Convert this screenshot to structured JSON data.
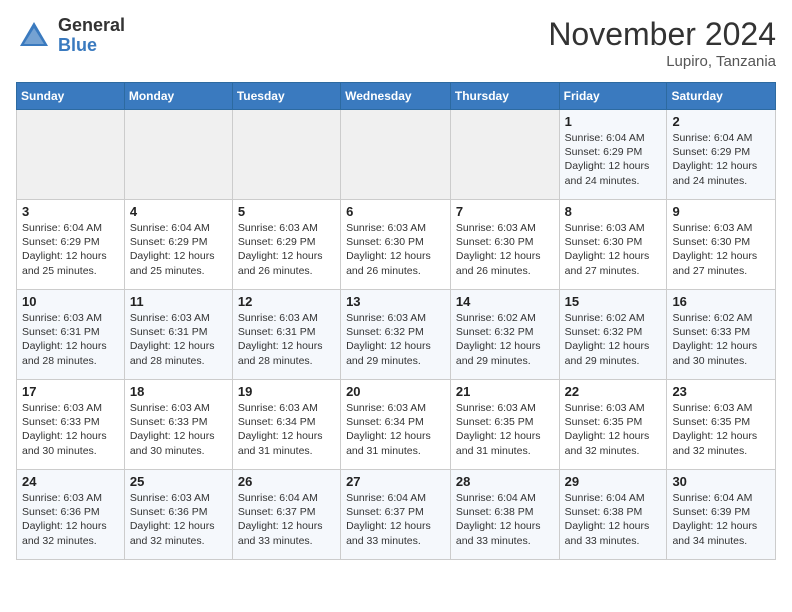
{
  "header": {
    "logo_general": "General",
    "logo_blue": "Blue",
    "month_title": "November 2024",
    "location": "Lupiro, Tanzania"
  },
  "weekdays": [
    "Sunday",
    "Monday",
    "Tuesday",
    "Wednesday",
    "Thursday",
    "Friday",
    "Saturday"
  ],
  "weeks": [
    [
      {
        "day": "",
        "info": ""
      },
      {
        "day": "",
        "info": ""
      },
      {
        "day": "",
        "info": ""
      },
      {
        "day": "",
        "info": ""
      },
      {
        "day": "",
        "info": ""
      },
      {
        "day": "1",
        "info": "Sunrise: 6:04 AM\nSunset: 6:29 PM\nDaylight: 12 hours and 24 minutes."
      },
      {
        "day": "2",
        "info": "Sunrise: 6:04 AM\nSunset: 6:29 PM\nDaylight: 12 hours and 24 minutes."
      }
    ],
    [
      {
        "day": "3",
        "info": "Sunrise: 6:04 AM\nSunset: 6:29 PM\nDaylight: 12 hours and 25 minutes."
      },
      {
        "day": "4",
        "info": "Sunrise: 6:04 AM\nSunset: 6:29 PM\nDaylight: 12 hours and 25 minutes."
      },
      {
        "day": "5",
        "info": "Sunrise: 6:03 AM\nSunset: 6:29 PM\nDaylight: 12 hours and 26 minutes."
      },
      {
        "day": "6",
        "info": "Sunrise: 6:03 AM\nSunset: 6:30 PM\nDaylight: 12 hours and 26 minutes."
      },
      {
        "day": "7",
        "info": "Sunrise: 6:03 AM\nSunset: 6:30 PM\nDaylight: 12 hours and 26 minutes."
      },
      {
        "day": "8",
        "info": "Sunrise: 6:03 AM\nSunset: 6:30 PM\nDaylight: 12 hours and 27 minutes."
      },
      {
        "day": "9",
        "info": "Sunrise: 6:03 AM\nSunset: 6:30 PM\nDaylight: 12 hours and 27 minutes."
      }
    ],
    [
      {
        "day": "10",
        "info": "Sunrise: 6:03 AM\nSunset: 6:31 PM\nDaylight: 12 hours and 28 minutes."
      },
      {
        "day": "11",
        "info": "Sunrise: 6:03 AM\nSunset: 6:31 PM\nDaylight: 12 hours and 28 minutes."
      },
      {
        "day": "12",
        "info": "Sunrise: 6:03 AM\nSunset: 6:31 PM\nDaylight: 12 hours and 28 minutes."
      },
      {
        "day": "13",
        "info": "Sunrise: 6:03 AM\nSunset: 6:32 PM\nDaylight: 12 hours and 29 minutes."
      },
      {
        "day": "14",
        "info": "Sunrise: 6:02 AM\nSunset: 6:32 PM\nDaylight: 12 hours and 29 minutes."
      },
      {
        "day": "15",
        "info": "Sunrise: 6:02 AM\nSunset: 6:32 PM\nDaylight: 12 hours and 29 minutes."
      },
      {
        "day": "16",
        "info": "Sunrise: 6:02 AM\nSunset: 6:33 PM\nDaylight: 12 hours and 30 minutes."
      }
    ],
    [
      {
        "day": "17",
        "info": "Sunrise: 6:03 AM\nSunset: 6:33 PM\nDaylight: 12 hours and 30 minutes."
      },
      {
        "day": "18",
        "info": "Sunrise: 6:03 AM\nSunset: 6:33 PM\nDaylight: 12 hours and 30 minutes."
      },
      {
        "day": "19",
        "info": "Sunrise: 6:03 AM\nSunset: 6:34 PM\nDaylight: 12 hours and 31 minutes."
      },
      {
        "day": "20",
        "info": "Sunrise: 6:03 AM\nSunset: 6:34 PM\nDaylight: 12 hours and 31 minutes."
      },
      {
        "day": "21",
        "info": "Sunrise: 6:03 AM\nSunset: 6:35 PM\nDaylight: 12 hours and 31 minutes."
      },
      {
        "day": "22",
        "info": "Sunrise: 6:03 AM\nSunset: 6:35 PM\nDaylight: 12 hours and 32 minutes."
      },
      {
        "day": "23",
        "info": "Sunrise: 6:03 AM\nSunset: 6:35 PM\nDaylight: 12 hours and 32 minutes."
      }
    ],
    [
      {
        "day": "24",
        "info": "Sunrise: 6:03 AM\nSunset: 6:36 PM\nDaylight: 12 hours and 32 minutes."
      },
      {
        "day": "25",
        "info": "Sunrise: 6:03 AM\nSunset: 6:36 PM\nDaylight: 12 hours and 32 minutes."
      },
      {
        "day": "26",
        "info": "Sunrise: 6:04 AM\nSunset: 6:37 PM\nDaylight: 12 hours and 33 minutes."
      },
      {
        "day": "27",
        "info": "Sunrise: 6:04 AM\nSunset: 6:37 PM\nDaylight: 12 hours and 33 minutes."
      },
      {
        "day": "28",
        "info": "Sunrise: 6:04 AM\nSunset: 6:38 PM\nDaylight: 12 hours and 33 minutes."
      },
      {
        "day": "29",
        "info": "Sunrise: 6:04 AM\nSunset: 6:38 PM\nDaylight: 12 hours and 33 minutes."
      },
      {
        "day": "30",
        "info": "Sunrise: 6:04 AM\nSunset: 6:39 PM\nDaylight: 12 hours and 34 minutes."
      }
    ]
  ]
}
